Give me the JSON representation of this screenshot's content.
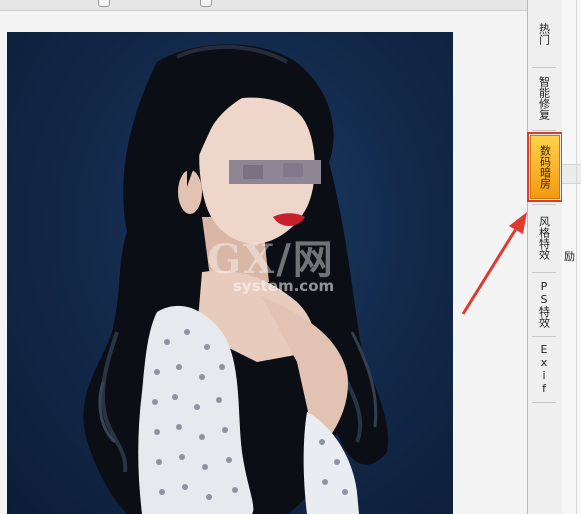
{
  "sidebar": {
    "tabs": [
      {
        "id": "hot",
        "label": "热门"
      },
      {
        "id": "smart-repair",
        "label": "智能修复"
      },
      {
        "id": "digital-darkroom",
        "label": "数码暗房"
      },
      {
        "id": "style-effects",
        "label": "风格特效"
      },
      {
        "id": "ps-effects",
        "label": "PS特效"
      },
      {
        "id": "exif",
        "label": "Exif"
      }
    ],
    "highlighted": "digital-darkroom",
    "highlight_color": "#e0392e",
    "active_tab_color": "#f7b52a"
  },
  "watermark": {
    "logo": "GX/网",
    "domain": "system.com"
  },
  "right_pane": {
    "glyph": "励"
  },
  "icons": {
    "annotation_arrow": "arrow-pointer-icon"
  }
}
